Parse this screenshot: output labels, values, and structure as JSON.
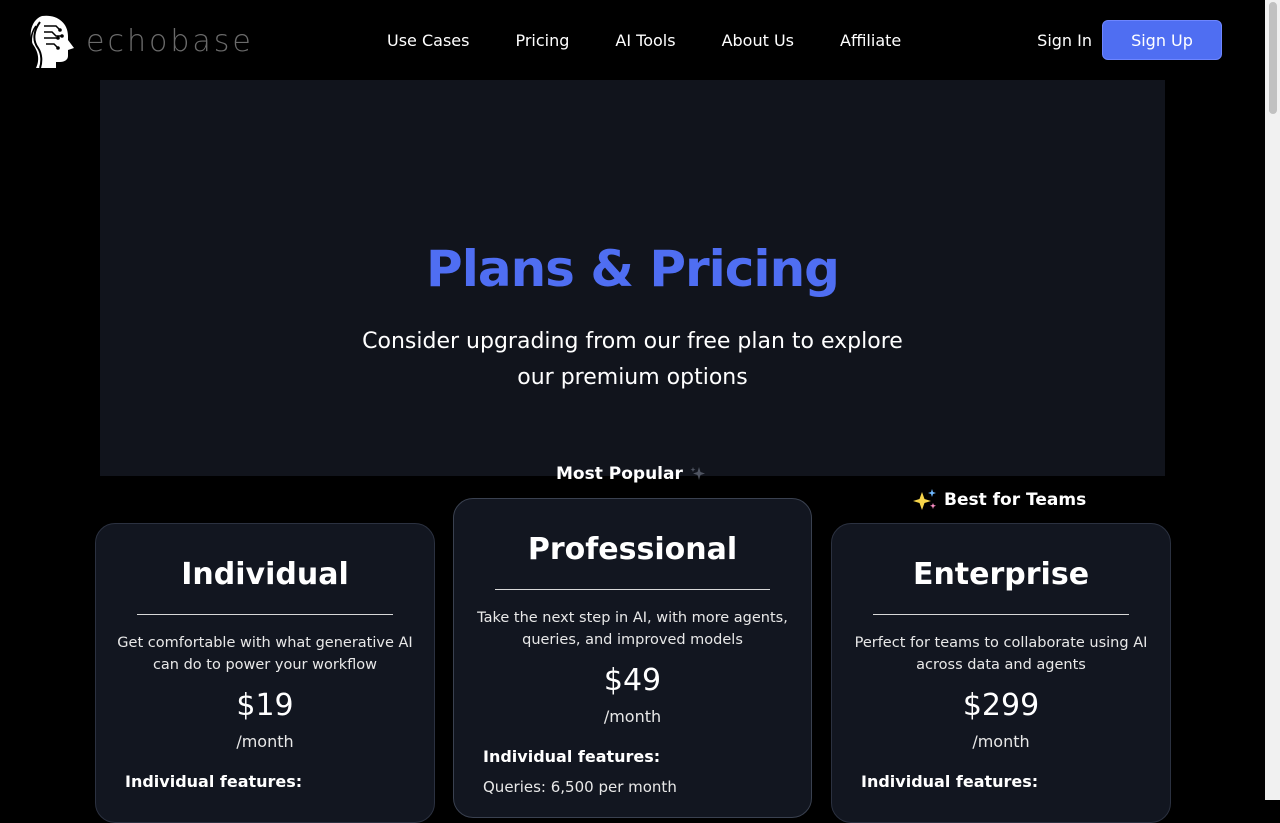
{
  "brand": {
    "name": "echobase"
  },
  "nav": {
    "items": [
      {
        "label": "Use Cases"
      },
      {
        "label": "Pricing"
      },
      {
        "label": "AI Tools"
      },
      {
        "label": "About Us"
      },
      {
        "label": "Affiliate"
      }
    ],
    "sign_in": "Sign In",
    "sign_up": "Sign Up"
  },
  "hero": {
    "title": "Plans & Pricing",
    "subtitle": "Consider upgrading from our free plan to explore our premium options"
  },
  "badges": {
    "popular": "Most Popular",
    "teams": "Best for Teams"
  },
  "plans": [
    {
      "name": "Individual",
      "description": "Get comfortable with what generative AI can do to power your workflow",
      "price": "$19",
      "period": "/month",
      "features_title": "Individual features:",
      "first_feature": ""
    },
    {
      "name": "Professional",
      "description": "Take the next step in AI, with more agents, queries, and improved models",
      "price": "$49",
      "period": "/month",
      "features_title": "Individual features:",
      "first_feature": "Queries: 6,500 per month"
    },
    {
      "name": "Enterprise",
      "description": "Perfect for teams to collaborate using AI across data and agents",
      "price": "$299",
      "period": "/month",
      "features_title": "Individual features:",
      "first_feature": ""
    }
  ],
  "colors": {
    "accent": "#4f6ef2",
    "background": "#000000",
    "hero_bg": "#11141c",
    "card_bg": "#121620"
  },
  "icons": {
    "logo": "ai-head-logo-icon",
    "sparkle": "sparkles-icon"
  }
}
